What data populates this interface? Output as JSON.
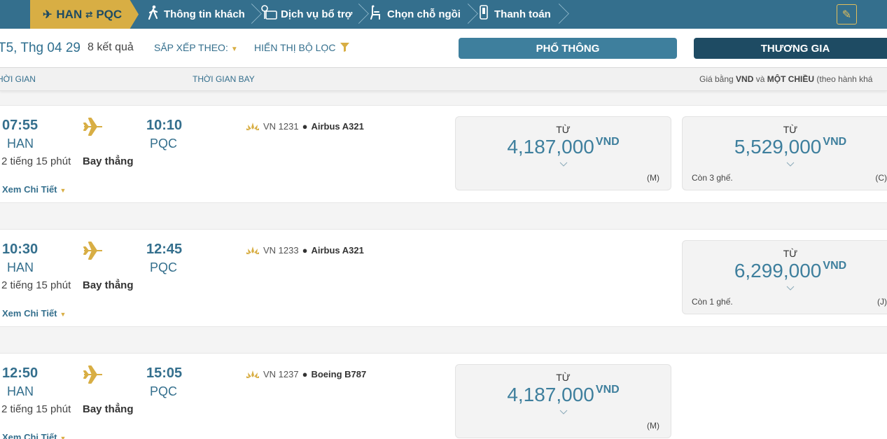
{
  "steps": {
    "route_from": "HAN",
    "route_swap": "⇄",
    "route_to": "PQC",
    "passenger_info": "Thông tin khách",
    "services": "Dịch vụ bổ trợ",
    "seat_selection": "Chọn chỗ ngồi",
    "payment": "Thanh toán"
  },
  "filters": {
    "date": "T5, Thg 04 29",
    "result_count": "8 kết quả",
    "sort_label": "SẮP XẾP THEO:",
    "filter_label": "HIỂN THỊ BỘ LỌC"
  },
  "cabins": {
    "economy": "PHỔ THÔNG",
    "business": "THƯƠNG GIA"
  },
  "columns": {
    "time": "HỜI GIAN",
    "flight_time": "THỜI GIAN BAY",
    "note_prefix": "Giá bằng ",
    "note_currency": "VND",
    "note_mid": " và ",
    "note_oneway": "MỘT CHIỀU",
    "note_suffix": " (theo hành khá"
  },
  "flights": [
    {
      "dep_time": "07:55",
      "dep_code": "HAN",
      "arr_time": "10:10",
      "arr_code": "PQC",
      "duration": "2 tiếng 15 phút",
      "stops": "Bay thẳng",
      "details": "Xem Chi Tiết",
      "flight_no": "VN 1231",
      "aircraft": "Airbus A321",
      "economy": {
        "from": "TỪ",
        "price": "4,187,000",
        "currency": "VND",
        "seats": "",
        "class": "(M)"
      },
      "business": {
        "from": "TỪ",
        "price": "5,529,000",
        "currency": "VND",
        "seats": "Còn 3 ghế.",
        "class": "(C)"
      }
    },
    {
      "dep_time": "10:30",
      "dep_code": "HAN",
      "arr_time": "12:45",
      "arr_code": "PQC",
      "duration": "2 tiếng 15 phút",
      "stops": "Bay thẳng",
      "details": "Xem Chi Tiết",
      "flight_no": "VN 1233",
      "aircraft": "Airbus A321",
      "business": {
        "from": "TỪ",
        "price": "6,299,000",
        "currency": "VND",
        "seats": "Còn 1 ghế.",
        "class": "(J)"
      }
    },
    {
      "dep_time": "12:50",
      "dep_code": "HAN",
      "arr_time": "15:05",
      "arr_code": "PQC",
      "duration": "2 tiếng 15 phút",
      "stops": "Bay thẳng",
      "details": "Xem Chi Tiết",
      "flight_no": "VN 1237",
      "aircraft": "Boeing B787",
      "economy": {
        "from": "TỪ",
        "price": "4,187,000",
        "currency": "VND",
        "seats": "",
        "class": "(M)"
      }
    }
  ],
  "colors": {
    "primary": "#346f8d",
    "accent": "#d8ae44",
    "dark": "#1e4b63"
  }
}
